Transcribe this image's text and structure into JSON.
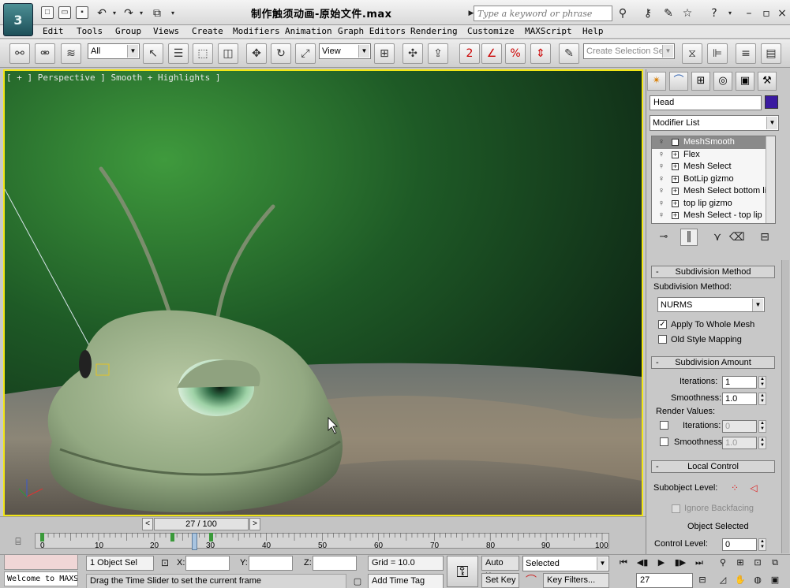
{
  "title_bar": {
    "document_title": "制作触须动画-原始文件.max",
    "search_placeholder": "Type a keyword or phrase",
    "app_logo": "3"
  },
  "menu": [
    "Edit",
    "Tools",
    "Group",
    "Views",
    "Create",
    "Modifiers",
    "Animation",
    "Graph Editors",
    "Rendering",
    "Customize",
    "MAXScript",
    "Help"
  ],
  "toolbar": {
    "selection_filter": "All",
    "reference_coord": "View",
    "snap_toggle_label": "2",
    "named_selection_placeholder": "Create Selection Set"
  },
  "viewport": {
    "label": "[ + ] Perspective ] Smooth + Highlights ]"
  },
  "command_panel": {
    "object_name": "Head",
    "object_color": "#3a1aa0",
    "modifier_list": "Modifier List",
    "modifier_stack": [
      "MeshSmooth",
      "Flex",
      "Mesh Select",
      "BotLip gizmo",
      "Mesh Select bottom lip",
      "top lip gizmo",
      "Mesh Select - top lip"
    ],
    "subdivision_method": {
      "title": "Subdivision Method",
      "label": "Subdivision Method:",
      "value": "NURMS",
      "apply_whole_mesh": "Apply To Whole Mesh",
      "apply_whole_mesh_checked": true,
      "old_style_mapping": "Old Style Mapping",
      "old_style_mapping_checked": false
    },
    "subdivision_amount": {
      "title": "Subdivision Amount",
      "iterations_label": "Iterations:",
      "iterations": "1",
      "smoothness_label": "Smoothness:",
      "smoothness": "1.0",
      "render_values": "Render Values:",
      "render_iterations": "0",
      "render_smoothness": "1.0"
    },
    "local_control": {
      "title": "Local Control",
      "subobject_label": "Subobject Level:",
      "ignore_backfacing": "Ignore Backfacing",
      "object_selected": "Object Selected",
      "control_level_label": "Control Level:",
      "control_level": "0"
    }
  },
  "timeline": {
    "frame_display": "27 / 100",
    "prev": "<",
    "next": ">",
    "ticks": [
      "0",
      "10",
      "20",
      "30",
      "40",
      "50",
      "60",
      "70",
      "80",
      "90",
      "100"
    ]
  },
  "status_bar": {
    "listener": "Welcome to MAXS",
    "selection_info": "1 Object Sel",
    "x_label": "X:",
    "y_label": "Y:",
    "z_label": "Z:",
    "x_value": "",
    "y_value": "",
    "z_value": "",
    "grid": "Grid = 10.0",
    "prompt": "Drag the Time Slider to set the current frame",
    "add_time_tag": "Add Time Tag",
    "auto_key": "Auto Key",
    "set_key": "Set Key",
    "key_mode": "Selected",
    "key_filters": "Key Filters...",
    "current_frame": "27"
  },
  "colors": {
    "viewport_border": "#f2e616",
    "active_modifier_bg": "#8a8a8a",
    "time_slider": "#a8c4e0"
  }
}
